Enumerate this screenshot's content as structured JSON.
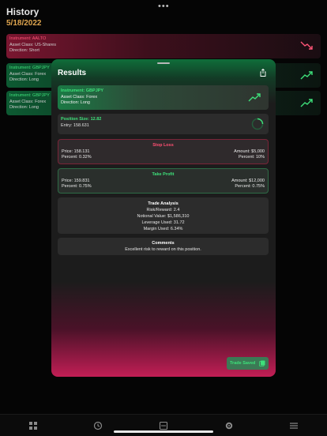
{
  "history": {
    "title": "History",
    "date": "5/18/2022",
    "items": [
      {
        "instrument": "Instrument: AALTO",
        "asset_class": "Asset Class: US-Shares",
        "direction": "Direction: Short"
      },
      {
        "instrument": "Instrument: GBPJPY",
        "asset_class": "Asset Class: Forex",
        "direction": "Direction: Long"
      },
      {
        "instrument": "Instrument: GBPJPY",
        "asset_class": "Asset Class: Forex",
        "direction": "Direction: Long"
      }
    ]
  },
  "results": {
    "title": "Results",
    "instrument": {
      "name": "Instrument: GBPJPY",
      "asset_class": "Asset Class: Forex",
      "direction": "Direction: Long"
    },
    "position": {
      "size": "Position Size: 12.82",
      "entry": "Entry: 158.631"
    },
    "stop_loss": {
      "title": "Stop Loss",
      "price": "Price: 158.131",
      "percent": "Percent: 0.32%",
      "amount": "Amount:  $5,000",
      "percent_right": "Percent: 10%"
    },
    "take_profit": {
      "title": "Take Profit",
      "price": "Price: 159.831",
      "percent": "Percent: 0.75%",
      "amount": "Amount:  $12,000",
      "percent_right": "Percent: 0.75%"
    },
    "trade_analysis": {
      "title": "Trade Analysis",
      "risk_reward": "Risk/Reward: 2.4",
      "notional": "Notional Value:  $1,586,310",
      "leverage": "Leverage Used: 31.72",
      "margin": "Margin Used: 6.34%"
    },
    "comments": {
      "title": "Comments",
      "text": "Excellent risk to reward on this position."
    },
    "save_button": "Trade Saved"
  },
  "colors": {
    "green": "#3ee07a",
    "red": "#ff4f72",
    "date_orange": "#e0a64f"
  },
  "icons": [
    "share-icon",
    "trend-up-icon",
    "trend-down-icon",
    "progress-ring-icon",
    "saved-icon",
    "grid-icon",
    "history-icon",
    "calculator-icon",
    "gear-icon",
    "menu-icon"
  ]
}
